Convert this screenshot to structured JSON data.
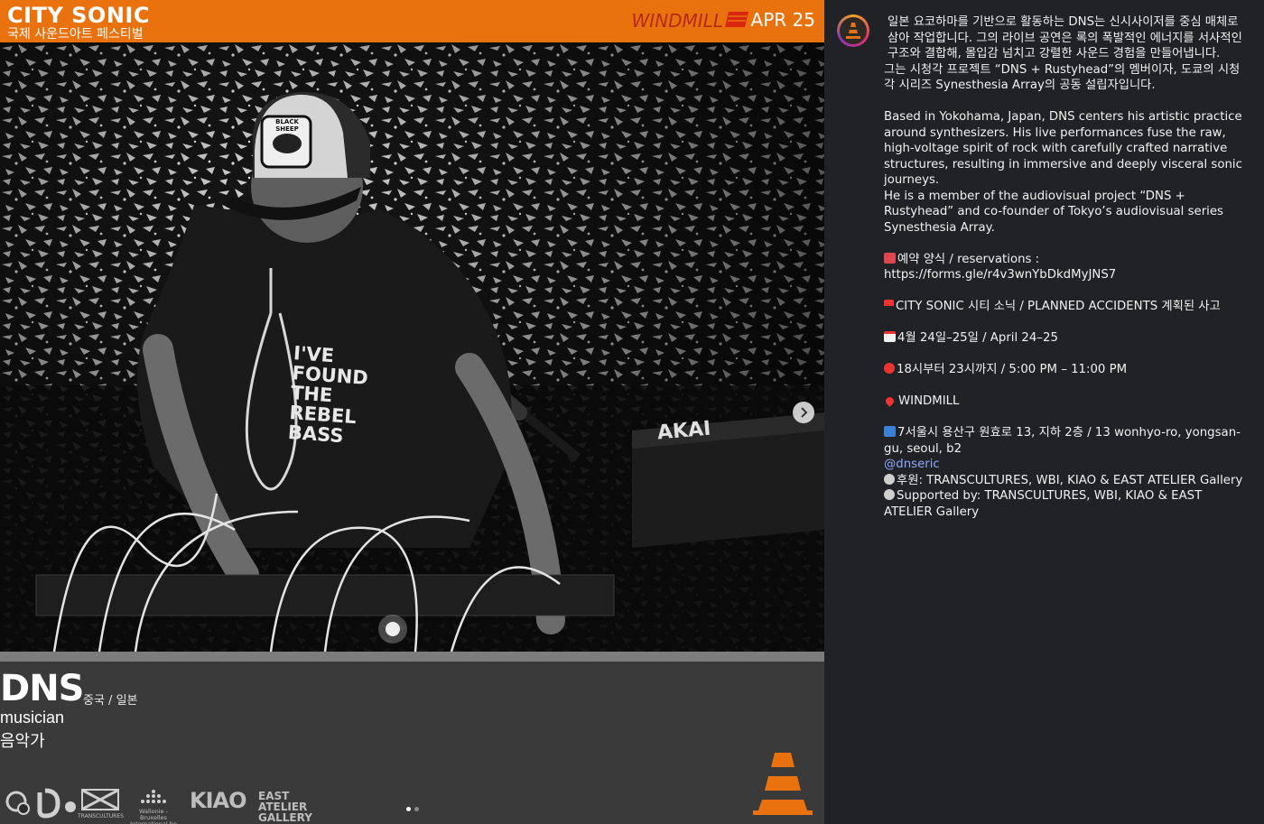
{
  "poster": {
    "brand_title": "CITY SONIC",
    "brand_subtitle": "국제 사운드아트 페스티벌",
    "venue": "WINDMILL",
    "date": "APR 25",
    "artist_name": "DNS",
    "artist_origin": "중국 / 일본",
    "artist_role_en": "musician",
    "artist_role_ko": "음악가",
    "shirt_text": [
      "I'VE",
      "FOUND",
      "THE",
      "REBEL",
      "BASS"
    ],
    "cap_patch": "BLACK SHEEP",
    "keyboard_brand": "AKAI",
    "sponsors": [
      {
        "name": "TRANSCULTURES"
      },
      {
        "name": "Wallonie - Bruxelles International.be"
      },
      {
        "name": "KIAO"
      },
      {
        "name": "EAST ATELIER GALLERY SEOUL"
      }
    ],
    "carousel": {
      "count": 2,
      "active": 0
    },
    "colors": {
      "header": "#e9720f",
      "venue": "#b52a0e",
      "cone": "#e9720f"
    }
  },
  "caption": {
    "ko_intro": "일본 요코하마를 기반으로 활동하는 DNS는 신시사이저를 중심 매체로 삼아 작업합니다. 그의 라이브 공연은 록의 폭발적인 에너지를 서사적인 구조와 결합해, 몰입감 넘치고 강렬한 사운드 경험을 만들어냅니다.",
    "ko_member": "그는 시청각 프로젝트 “DNS + Rustyhead”의 멤버이자, 도쿄의 시청각 시리즈 Synesthesia Array의 공동 설립자입니다.",
    "en_intro": "Based in Yokohama, Japan, DNS centers his artistic practice around synthesizers. His live performances fuse the raw, high-voltage spirit of rock with carefully crafted narrative structures, resulting in immersive and deeply visceral sonic journeys.",
    "en_member": "He is a member of the audiovisual project “DNS + Rustyhead” and co-founder of Tokyo’s audiovisual series Synesthesia Array.",
    "reservation_label": "예약 양식 / reservations :",
    "reservation_url": "https://forms.gle/r4v3wnYbDkdMyJNS7",
    "event_line": "CITY SONIC 시티 소닉 / PLANNED ACCIDENTS 계획된 사고",
    "date_line": "4월 24일–25일 / April 24–25",
    "time_line": "18시부터 23시까지 / 5:00 PM – 11:00 PM",
    "venue_line": "WINDMILL",
    "address_line": "7서울시 용산구 원효로 13, 지하 2층 / 13 wonhyo-ro, yongsan-gu, seoul, b2",
    "handle": "@dnseric",
    "sponsor_ko": "후원: TRANSCULTURES, WBI, KIAO & EAST ATELIER Gallery",
    "sponsor_en": "Supported by: TRANSCULTURES, WBI, KIAO & EAST ATELIER Gallery",
    "colors": {
      "text": "#f1f1f1",
      "link": "#8fa9ff",
      "background": "#212225"
    }
  }
}
